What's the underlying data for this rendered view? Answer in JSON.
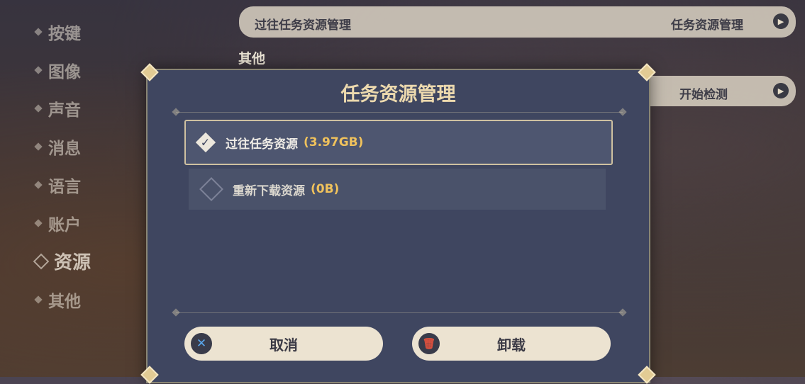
{
  "sidebar": {
    "items": [
      {
        "label": "按键"
      },
      {
        "label": "图像"
      },
      {
        "label": "声音"
      },
      {
        "label": "消息"
      },
      {
        "label": "语言"
      },
      {
        "label": "账户"
      },
      {
        "label": "资源",
        "active": true
      },
      {
        "label": "其他"
      }
    ]
  },
  "background": {
    "row1_label": "过往任务资源管理",
    "row1_value": "任务资源管理",
    "section": "其他",
    "row2_value": "开始检测",
    "arrow_icon": "play-icon"
  },
  "dialog": {
    "title": "任务资源管理",
    "options": [
      {
        "label": "过往任务资源",
        "size": "(3.97GB)",
        "selected": true
      },
      {
        "label": "重新下载资源",
        "size": "(0B)",
        "selected": false
      }
    ],
    "cancel_label": "取消",
    "uninstall_label": "卸载",
    "cancel_icon": "close-icon",
    "uninstall_icon": "trash-icon"
  },
  "colors": {
    "accent_gold": "#f0c25c",
    "dialog_bg": "#3f4660",
    "button_bg": "#ece3d1"
  }
}
